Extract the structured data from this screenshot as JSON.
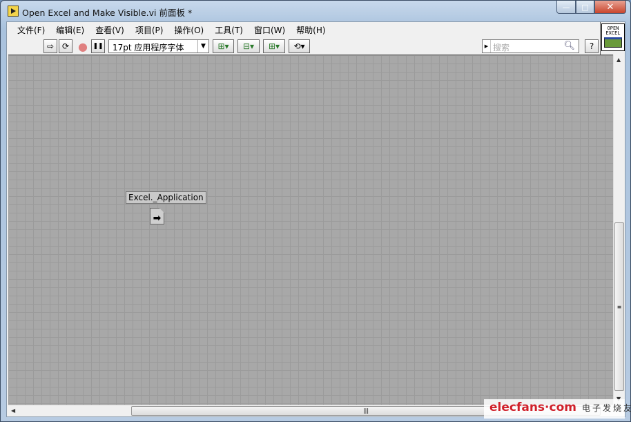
{
  "window": {
    "title": "Open Excel and Make Visible.vi 前面板 *",
    "minimize": "—",
    "maximize": "□",
    "close": "✕"
  },
  "menu": [
    "文件(F)",
    "编辑(E)",
    "查看(V)",
    "项目(P)",
    "操作(O)",
    "工具(T)",
    "窗口(W)",
    "帮助(H)"
  ],
  "toolbar": {
    "run": "⇨",
    "run_continuous": "⟳",
    "abort": "●",
    "pause": "❚❚",
    "font": "17pt 应用程序字体",
    "align": "⊞▾",
    "distribute": "⊟▾",
    "resize": "⊞▾",
    "reorder": "⟲▾",
    "help": "?"
  },
  "search": {
    "placeholder": "搜索"
  },
  "vi_icon": {
    "text": "OPEN EXCEL"
  },
  "canvas": {
    "control_label": "Excel._Application",
    "refnum_glyph": "➡"
  },
  "watermark": {
    "brand": "elecfans·com",
    "cn": "电子发烧友"
  }
}
